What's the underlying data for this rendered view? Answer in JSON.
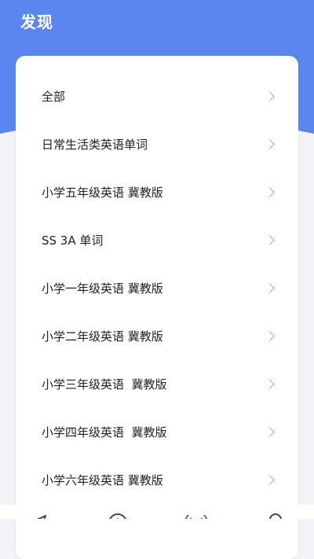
{
  "header": {
    "title": "发现",
    "bg_color": "#5b86f0"
  },
  "categories": [
    {
      "label": "全部",
      "icon": "chevron-right-icon"
    },
    {
      "label": "日常生活类英语单词",
      "icon": "chevron-right-icon"
    },
    {
      "label": "小学五年级英语 冀教版",
      "icon": "chevron-right-icon"
    },
    {
      "label": "SS 3A 单词",
      "icon": "chevron-right-icon"
    },
    {
      "label": "小学一年级英语 冀教版",
      "icon": "chevron-right-icon"
    },
    {
      "label": "小学二年级英语 冀教版",
      "icon": "chevron-right-icon"
    },
    {
      "label": "小学三年级英语  冀教版",
      "icon": "chevron-right-icon"
    },
    {
      "label": "小学四年级英语  冀教版",
      "icon": "chevron-right-icon"
    },
    {
      "label": "小学六年级英语 冀教版",
      "icon": "chevron-right-icon"
    }
  ],
  "bottom_nav": {
    "items": [
      {
        "icon": "paper-plane-icon",
        "active": false
      },
      {
        "icon": "compass-icon",
        "active": false
      },
      {
        "icon": "broadcast-icon",
        "active": true
      },
      {
        "icon": "profile-icon",
        "active": false
      }
    ],
    "active_color": "#3f6fe6",
    "inactive_color": "#444444"
  }
}
